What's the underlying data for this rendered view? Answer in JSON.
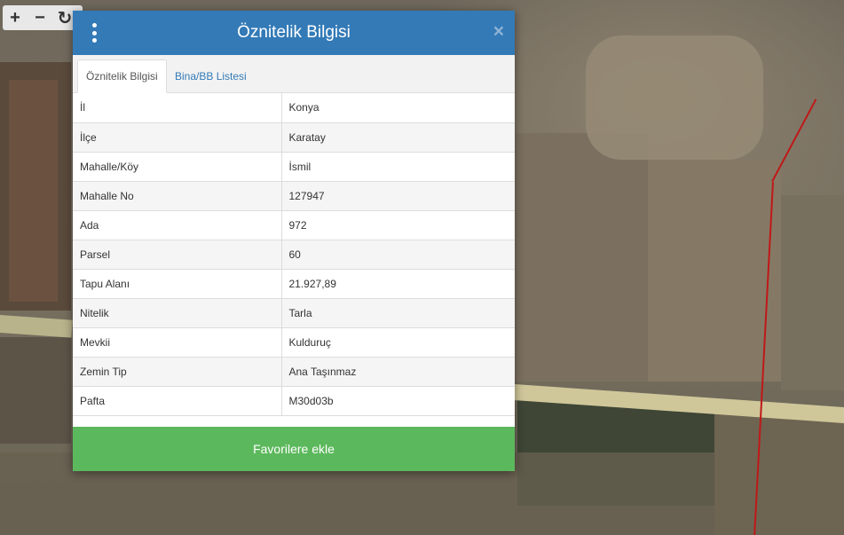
{
  "toolbar": {
    "zoom_in": "+",
    "zoom_out": "−",
    "refresh": "↻"
  },
  "dialog": {
    "title": "Öznitelik Bilgisi",
    "tabs": [
      {
        "label": "Öznitelik Bilgisi",
        "active": true
      },
      {
        "label": "Bina/BB Listesi",
        "active": false
      }
    ],
    "rows": [
      {
        "key": "İl",
        "value": "Konya"
      },
      {
        "key": "İlçe",
        "value": "Karatay"
      },
      {
        "key": "Mahalle/Köy",
        "value": "İsmil"
      },
      {
        "key": "Mahalle No",
        "value": "127947"
      },
      {
        "key": "Ada",
        "value": "972"
      },
      {
        "key": "Parsel",
        "value": "60"
      },
      {
        "key": "Tapu Alanı",
        "value": "21.927,89"
      },
      {
        "key": "Nitelik",
        "value": "Tarla"
      },
      {
        "key": "Mevkii",
        "value": "Kulduruç"
      },
      {
        "key": "Zemin Tip",
        "value": "Ana Taşınmaz"
      },
      {
        "key": "Pafta",
        "value": "M30d03b"
      }
    ],
    "favorite_label": "Favorilere ekle",
    "close_symbol": "×"
  },
  "colors": {
    "header": "#337ab7",
    "favorite_button": "#5cb85c",
    "parcel_boundary": "#c01818"
  }
}
